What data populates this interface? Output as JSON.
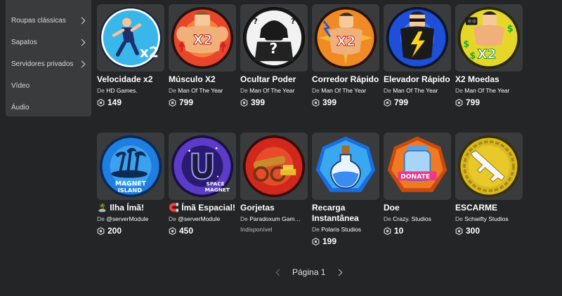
{
  "sidebar": {
    "items": [
      {
        "label": "Roupas clássicas"
      },
      {
        "label": "Sapatos"
      },
      {
        "label": "Servidores privados"
      },
      {
        "label": "Vídeo"
      },
      {
        "label": "Áudio"
      }
    ]
  },
  "items": [
    {
      "name": "Velocidade x2",
      "by": "De",
      "creator": "HD Games.",
      "price": "149",
      "icon": "speed-x2-icon"
    },
    {
      "name": "Músculo X2",
      "by": "De",
      "creator": "Man Of The Year",
      "price": "799",
      "icon": "muscle-x2-icon"
    },
    {
      "name": "Ocultar Poder",
      "by": "De",
      "creator": "Man Of The Year",
      "price": "399",
      "icon": "hidden-power-icon"
    },
    {
      "name": "Corredor Rápido",
      "by": "De",
      "creator": "Man Of The Year",
      "price": "399",
      "icon": "fast-runner-icon"
    },
    {
      "name": "Elevador Rápido",
      "by": "De",
      "creator": "Man Of The Year",
      "price": "799",
      "icon": "fast-lifter-icon"
    },
    {
      "name": "X2 Moedas",
      "by": "De",
      "creator": "Man Of The Year",
      "price": "799",
      "icon": "coins-x2-icon"
    },
    {
      "name": "🏝️ Ilha Ímã!",
      "by": "De",
      "creator": "@serverModule",
      "price": "200",
      "icon": "magnet-island-icon"
    },
    {
      "name": "🧲 Ímã Espacial!",
      "by": "De",
      "creator": "@serverModule",
      "price": "450",
      "icon": "space-magnet-icon"
    },
    {
      "name": "Gorjetas",
      "by": "De",
      "creator": "Paradoxum Gam…",
      "status": "Indisponível",
      "icon": "tips-cannon-icon"
    },
    {
      "name": "Recarga Instantânea",
      "by": "De",
      "creator": "Polaris Studios",
      "price": "199",
      "icon": "potion-icon"
    },
    {
      "name": "Doe",
      "by": "De",
      "creator": "Crazy. Studios",
      "price": "10",
      "icon": "donate-jar-icon"
    },
    {
      "name": "ESCARME",
      "by": "De",
      "creator": "Schwifty Studios",
      "price": "300",
      "icon": "rifle-icon"
    }
  ],
  "pagination": {
    "label": "Página 1"
  },
  "colors": {
    "background": "#232527",
    "card": "#393b3d",
    "sidebar": "#393b3d"
  }
}
